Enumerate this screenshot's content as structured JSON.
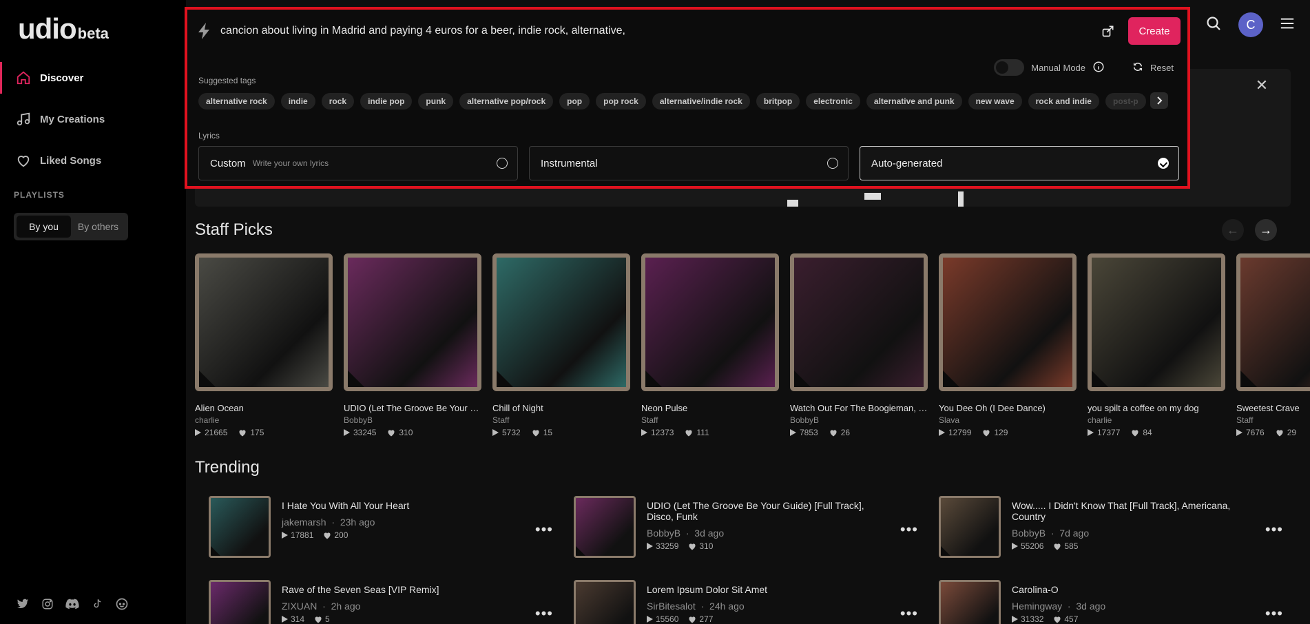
{
  "app": {
    "logo_word": "udio",
    "logo_suffix": "beta"
  },
  "sidebar": {
    "nav": [
      {
        "label": "Discover",
        "icon": "home-icon"
      },
      {
        "label": "My Creations",
        "icon": "music-note-icon"
      },
      {
        "label": "Liked Songs",
        "icon": "heart-icon"
      }
    ],
    "playlists_label": "PLAYLISTS",
    "segment": {
      "by_you": "By you",
      "by_others": "By others"
    },
    "social_icons": [
      "twitter-icon",
      "instagram-icon",
      "discord-icon",
      "tiktok-icon",
      "reddit-icon"
    ]
  },
  "header": {
    "avatar_initial": "C"
  },
  "create_panel": {
    "prompt": "cancion about living in Madrid and paying 4 euros for a beer, indie rock, alternative,",
    "create_label": "Create",
    "manual_mode_label": "Manual Mode",
    "reset_label": "Reset",
    "suggested_tags_label": "Suggested tags",
    "tags": [
      "alternative rock",
      "indie",
      "rock",
      "indie pop",
      "punk",
      "alternative pop/rock",
      "pop",
      "pop rock",
      "alternative/indie rock",
      "britpop",
      "electronic",
      "alternative and punk",
      "new wave",
      "rock and indie",
      "post-p"
    ],
    "lyrics_label": "Lyrics",
    "lyrics_options": [
      {
        "title": "Custom",
        "subtitle": "Write your own lyrics",
        "selected": false
      },
      {
        "title": "Instrumental",
        "subtitle": "",
        "selected": false
      },
      {
        "title": "Auto-generated",
        "subtitle": "",
        "selected": true
      }
    ]
  },
  "staff_picks": {
    "heading": "Staff Picks",
    "cards": [
      {
        "title": "Alien Ocean",
        "artist": "charlie",
        "plays": "21665",
        "likes": "175",
        "bg": "#4a4a44"
      },
      {
        "title": "UDIO (Let The Groove Be Your Guide)",
        "artist": "BobbyB",
        "plays": "33245",
        "likes": "310",
        "bg": "#6a2a5c"
      },
      {
        "title": "Chill of Night",
        "artist": "Staff",
        "plays": "5732",
        "likes": "15",
        "bg": "#2e6a66"
      },
      {
        "title": "Neon Pulse",
        "artist": "Staff",
        "plays": "12373",
        "likes": "111",
        "bg": "#5a2050"
      },
      {
        "title": "Watch Out For The Boogieman, Boogieman",
        "artist": "BobbyB",
        "plays": "7853",
        "likes": "26",
        "bg": "#3a1e2e"
      },
      {
        "title": "You Dee Oh (I Dee Dance)",
        "artist": "Slava",
        "plays": "12799",
        "likes": "129",
        "bg": "#7a3a2a"
      },
      {
        "title": "you spilt a coffee on my dog",
        "artist": "charlie",
        "plays": "17377",
        "likes": "84",
        "bg": "#4a4638"
      },
      {
        "title": "Sweetest Crave",
        "artist": "Staff",
        "plays": "7676",
        "likes": "29",
        "bg": "#6a3a2e"
      }
    ]
  },
  "trending": {
    "heading": "Trending",
    "rows": [
      {
        "title": "I Hate You With All Your Heart",
        "artist": "jakemarsh",
        "ago": "23h ago",
        "plays": "17881",
        "likes": "200",
        "bg": "#2a5a5a"
      },
      {
        "title": "UDIO (Let The Groove Be Your Guide) [Full Track], Disco, Funk",
        "artist": "BobbyB",
        "ago": "3d ago",
        "plays": "33259",
        "likes": "310",
        "bg": "#6a2a5c"
      },
      {
        "title": "Wow..... I Didn't Know That [Full Track], Americana, Country",
        "artist": "BobbyB",
        "ago": "7d ago",
        "plays": "55206",
        "likes": "585",
        "bg": "#5a4a3a"
      },
      {
        "title": "Rave of the Seven Seas [VIP Remix]",
        "artist": "ZIXUAN",
        "ago": "2h ago",
        "plays": "314",
        "likes": "5",
        "bg": "#6a2a6a"
      },
      {
        "title": "Lorem Ipsum Dolor Sit Amet",
        "artist": "SirBitesalot",
        "ago": "24h ago",
        "plays": "15560",
        "likes": "277",
        "bg": "#4a3a30"
      },
      {
        "title": "Carolina-O",
        "artist": "Hemingway",
        "ago": "3d ago",
        "plays": "31332",
        "likes": "457",
        "bg": "#7a4a3a"
      }
    ]
  },
  "colors": {
    "accent": "#e0245e",
    "highlight_border": "#e0121f",
    "avatar": "#5c62c7"
  }
}
